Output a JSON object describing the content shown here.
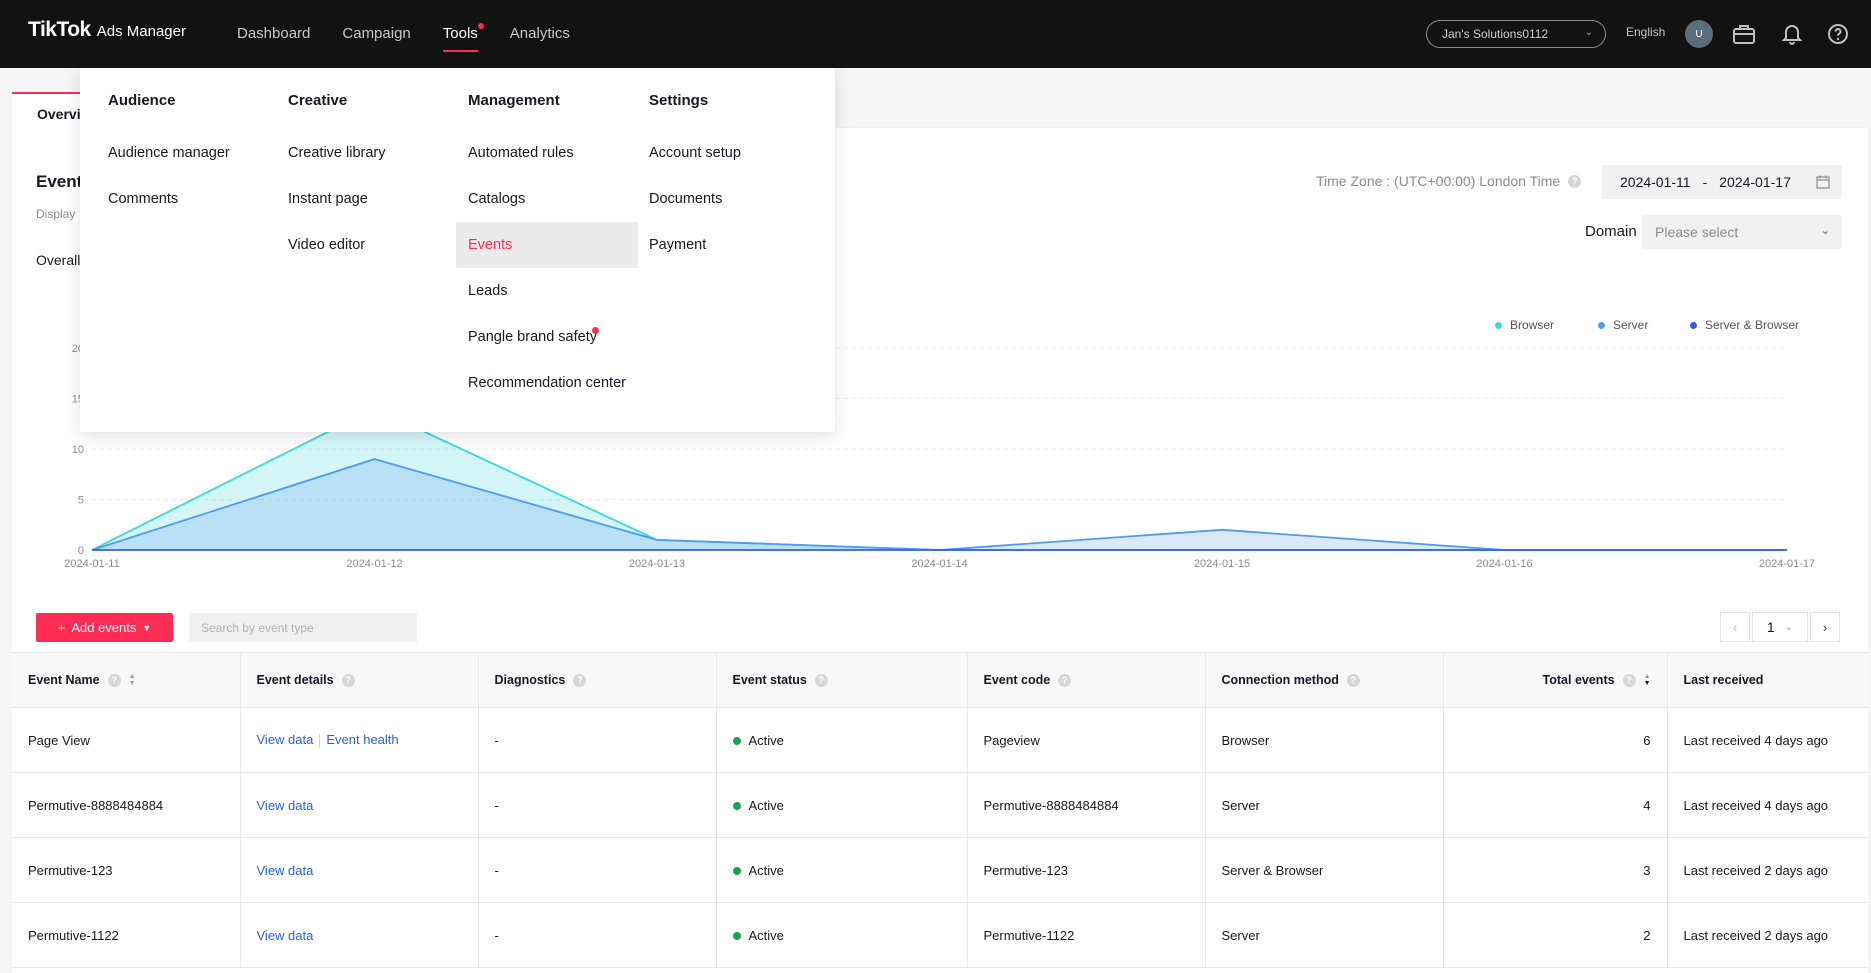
{
  "app": {
    "logo": "TikTok",
    "product": "Ads Manager"
  },
  "nav": [
    {
      "label": "Dashboard",
      "active": false
    },
    {
      "label": "Campaign",
      "active": false
    },
    {
      "label": "Tools",
      "active": true
    },
    {
      "label": "Analytics",
      "active": false
    }
  ],
  "header": {
    "account": "Jan's Solutions0112",
    "language": "English",
    "avatar_initial": "U"
  },
  "tabs": {
    "overview": "Overvi"
  },
  "events_section": {
    "title": "Event",
    "subtitle": "Display",
    "overall_label": "Overall"
  },
  "filters": {
    "timezone": "Time Zone : (UTC+00:00) London Time",
    "date_start": "2024-01-11",
    "date_sep": "-",
    "date_end": "2024-01-17",
    "domain_label": "Domain",
    "domain_placeholder": "Please select"
  },
  "chart_data": {
    "type": "area",
    "x": [
      "2024-01-11",
      "2024-01-12",
      "2024-01-13",
      "2024-01-14",
      "2024-01-15",
      "2024-01-16",
      "2024-01-17"
    ],
    "yticks": [
      "0",
      "5",
      "10",
      "15",
      "20"
    ],
    "ylim": [
      0,
      20
    ],
    "legend_position": "top-right",
    "series": [
      {
        "name": "Browser",
        "color": "#3ad6dc",
        "values": [
          0,
          14,
          1,
          0,
          0,
          0,
          0
        ]
      },
      {
        "name": "Server",
        "color": "#4f9bf0",
        "values": [
          0,
          9,
          1,
          0,
          2,
          0,
          0
        ]
      },
      {
        "name": "Server & Browser",
        "color": "#3e5be0",
        "values": [
          0,
          0,
          0,
          0,
          0,
          0,
          0
        ]
      }
    ]
  },
  "toolbar": {
    "add_events": "Add events",
    "search_placeholder": "Search by event type",
    "page": "1"
  },
  "table": {
    "headers": [
      "Event Name",
      "Event details",
      "Diagnostics",
      "Event status",
      "Event code",
      "Connection method",
      "Total events",
      "Last received"
    ],
    "rows": [
      {
        "name": "Page View",
        "details": [
          "View data",
          "Event health"
        ],
        "diagnostics": "-",
        "status": "Active",
        "code": "Pageview",
        "method": "Browser",
        "total": "6",
        "last": "Last received 4 days ago"
      },
      {
        "name": "Permutive-8888484884",
        "details": [
          "View data"
        ],
        "diagnostics": "-",
        "status": "Active",
        "code": "Permutive-8888484884",
        "method": "Server",
        "total": "4",
        "last": "Last received 4 days ago"
      },
      {
        "name": "Permutive-123",
        "details": [
          "View data"
        ],
        "diagnostics": "-",
        "status": "Active",
        "code": "Permutive-123",
        "method": "Server & Browser",
        "total": "3",
        "last": "Last received 2 days ago"
      },
      {
        "name": "Permutive-1122",
        "details": [
          "View data"
        ],
        "diagnostics": "-",
        "status": "Active",
        "code": "Permutive-1122",
        "method": "Server",
        "total": "2",
        "last": "Last received 2 days ago"
      }
    ]
  },
  "tools_menu": {
    "columns": [
      {
        "heading": "Audience",
        "items": [
          {
            "label": "Audience manager"
          },
          {
            "label": "Comments"
          }
        ]
      },
      {
        "heading": "Creative",
        "items": [
          {
            "label": "Creative library"
          },
          {
            "label": "Instant page"
          },
          {
            "label": "Video editor"
          }
        ]
      },
      {
        "heading": "Management",
        "items": [
          {
            "label": "Automated rules"
          },
          {
            "label": "Catalogs"
          },
          {
            "label": "Events",
            "selected": true
          },
          {
            "label": "Leads"
          },
          {
            "label": "Pangle brand safety",
            "badge": true
          },
          {
            "label": "Recommendation center"
          }
        ]
      },
      {
        "heading": "Settings",
        "items": [
          {
            "label": "Account setup"
          },
          {
            "label": "Documents"
          },
          {
            "label": "Payment"
          }
        ]
      }
    ]
  }
}
